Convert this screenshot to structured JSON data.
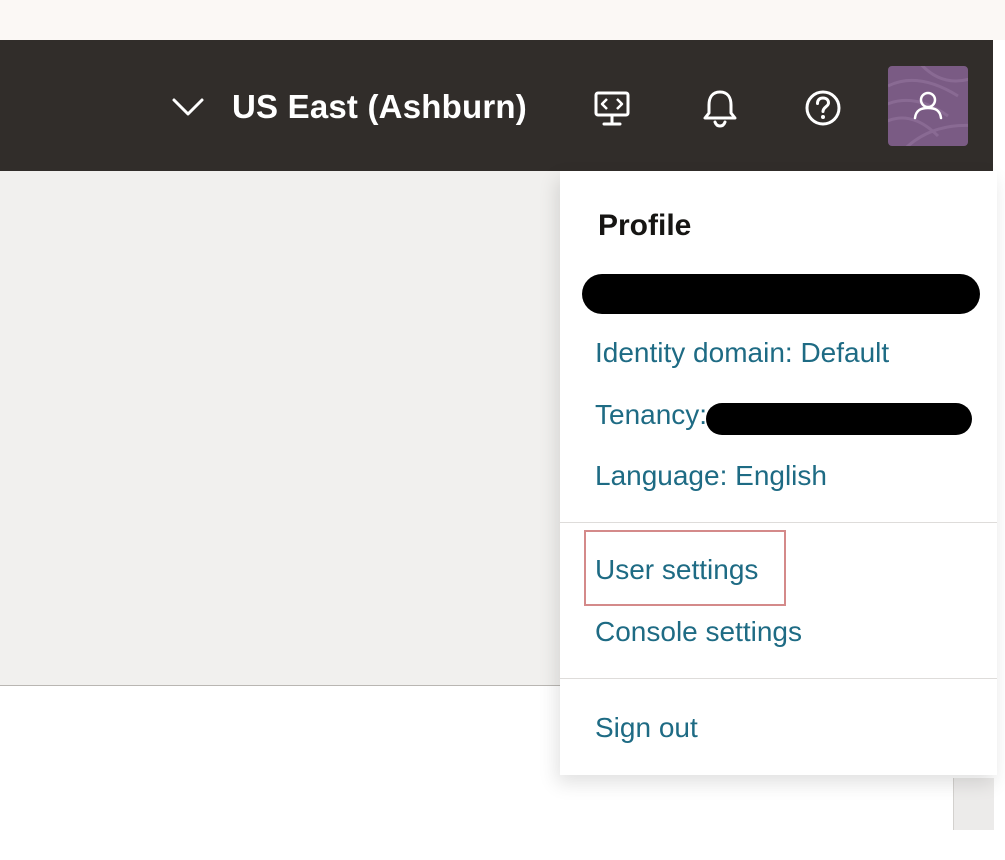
{
  "header": {
    "region": "US East (Ashburn)",
    "icons": [
      "chevron-down-icon",
      "code-editor-icon",
      "bell-icon",
      "help-icon",
      "avatar"
    ]
  },
  "profile_menu": {
    "title": "Profile",
    "identity_domain": "Identity domain: Default",
    "tenancy_label": "Tenancy:",
    "language": "Language: English",
    "user_settings": "User settings",
    "console_settings": "Console settings",
    "sign_out": "Sign out"
  },
  "colors": {
    "header_bg": "#312d2a",
    "link": "#1e6b84",
    "avatar_bg": "#7a5b84",
    "highlight": "#d48a8a"
  }
}
